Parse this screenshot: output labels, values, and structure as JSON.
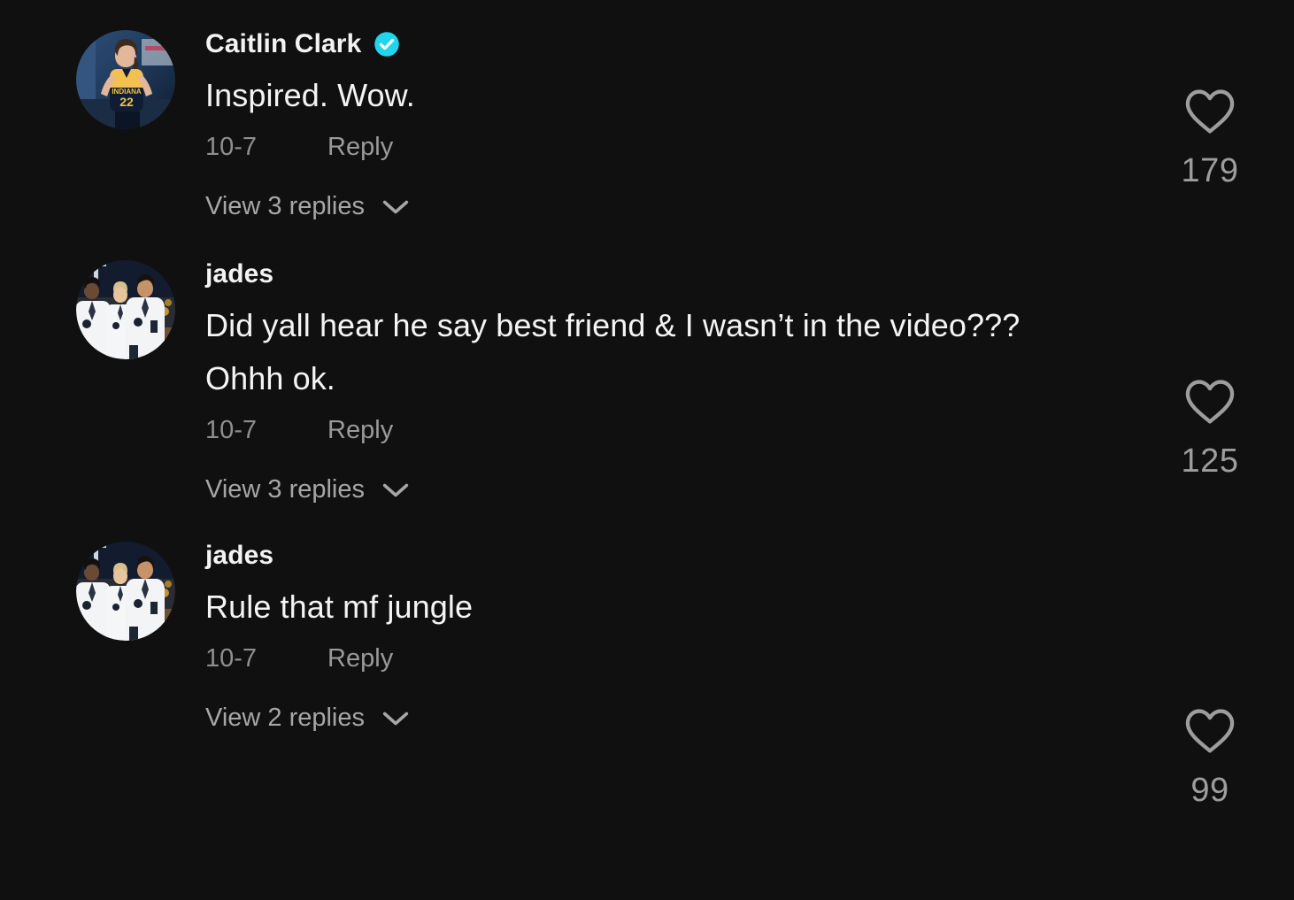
{
  "theme": {
    "background": "#101010",
    "primary_text": "#f4f4f4",
    "secondary_text": "#9a9a9a",
    "verified_badge_color": "#20d5ec",
    "heart_color": "#9d9d9d"
  },
  "comments": [
    {
      "username": "Caitlin Clark",
      "verified": true,
      "verified_icon": "verified-check-icon",
      "text": "Inspired. Wow.",
      "date": "10-7",
      "reply_label": "Reply",
      "view_replies_label": "View 3 replies",
      "chevron_icon": "chevron-down-icon",
      "heart_icon": "heart-outline-icon",
      "like_count": "179",
      "avatar_alt": "basketball-player-indiana-22"
    },
    {
      "username": "jades",
      "verified": false,
      "text": "Did yall hear he say best friend & I wasn’t in the video??? Ohhh ok.",
      "date": "10-7",
      "reply_label": "Reply",
      "view_replies_label": "View 3 replies",
      "chevron_icon": "chevron-down-icon",
      "heart_icon": "heart-outline-icon",
      "like_count": "125",
      "avatar_alt": "basketball-players-white-warmups"
    },
    {
      "username": "jades",
      "verified": false,
      "text": "Rule that mf jungle",
      "date": "10-7",
      "reply_label": "Reply",
      "view_replies_label": "View 2 replies",
      "chevron_icon": "chevron-down-icon",
      "heart_icon": "heart-outline-icon",
      "like_count": "99",
      "avatar_alt": "basketball-players-white-warmups"
    }
  ]
}
